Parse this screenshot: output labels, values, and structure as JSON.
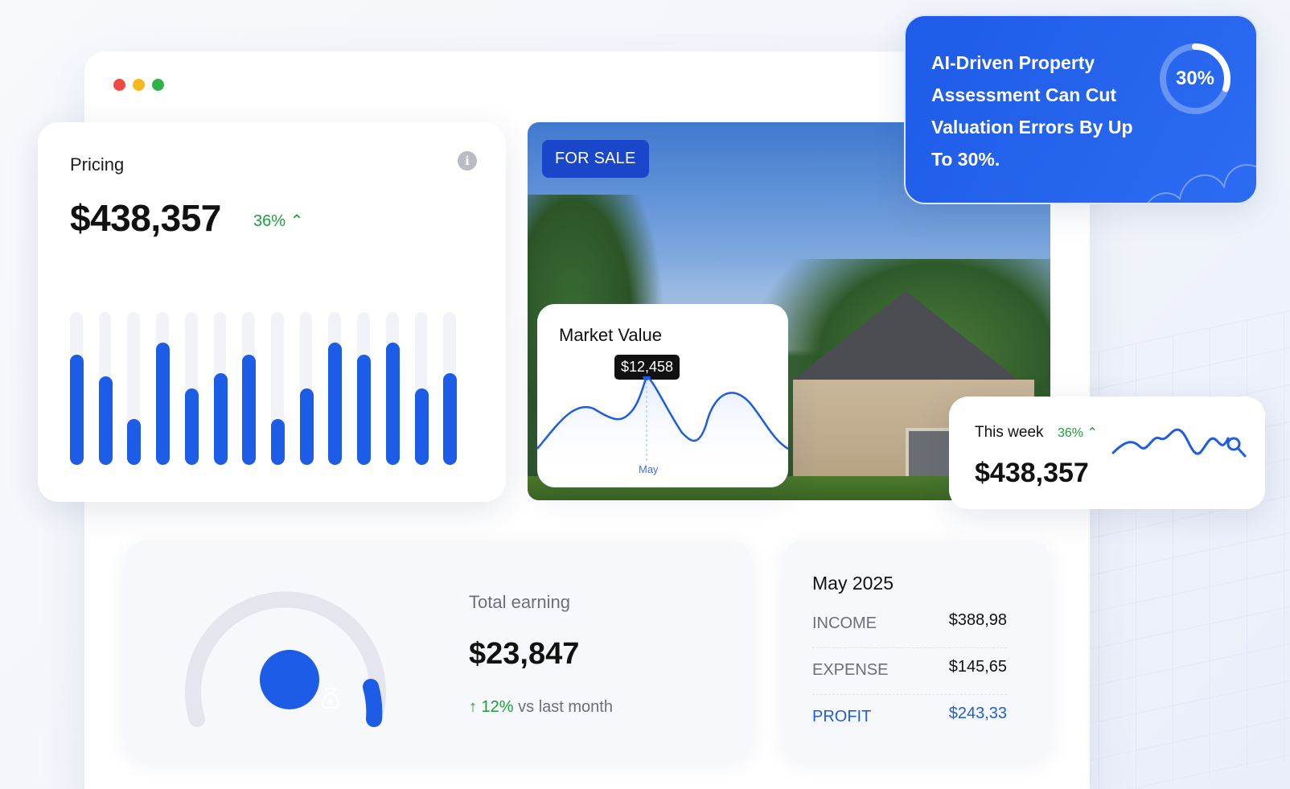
{
  "pricing": {
    "title": "Pricing",
    "value": "$438,357",
    "delta": "36% ⌃",
    "bars": [
      0.72,
      0.58,
      0.3,
      0.8,
      0.5,
      0.6,
      0.72,
      0.3,
      0.5,
      0.8,
      0.72,
      0.8,
      0.5,
      0.6
    ]
  },
  "listing": {
    "badge": "FOR SALE"
  },
  "market": {
    "title": "Market Value",
    "tooltip": "$12,458",
    "month": "May"
  },
  "ai": {
    "text": "AI-Driven Property Assessment Can Cut Valuation Errors By Up To 30%.",
    "percent": "30%"
  },
  "week": {
    "label": "This week",
    "delta": "36% ⌃",
    "value": "$438,357"
  },
  "earning": {
    "label": "Total earning",
    "value": "$23,847",
    "trend_value": "↑ 12%",
    "trend_text": " vs last month"
  },
  "month_summary": {
    "title": "May 2025",
    "rows": [
      {
        "key": "INCOME",
        "value": "$388,98"
      },
      {
        "key": "EXPENSE",
        "value": "$145,65"
      },
      {
        "key": "PROFIT",
        "value": "$243,33"
      }
    ]
  },
  "colors": {
    "accent": "#1d5ce6",
    "positive": "#1f9d3a"
  }
}
